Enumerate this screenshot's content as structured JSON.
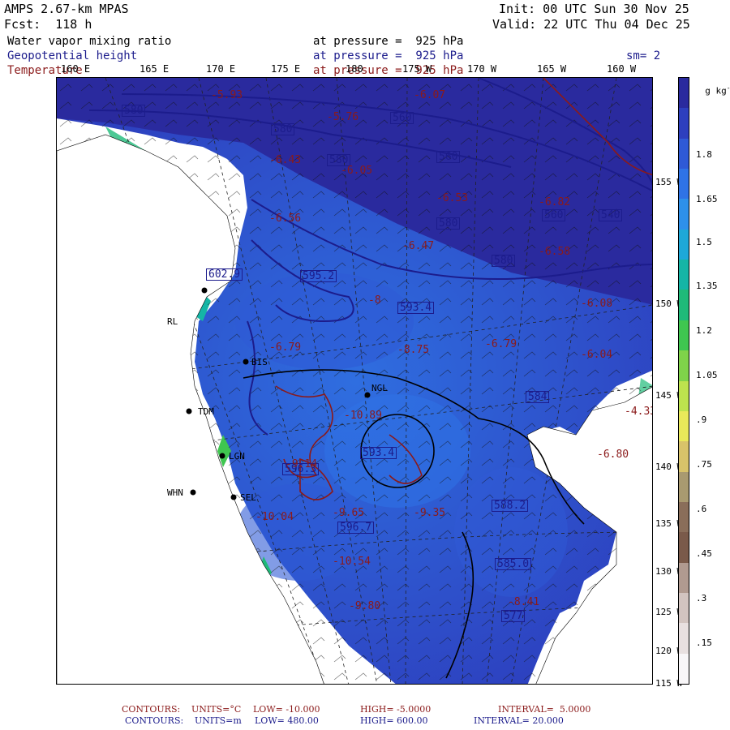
{
  "header": {
    "model": "AMPS 2.67-km MPAS",
    "forecast": "Fcst:  118 h",
    "init": "Init: 00 UTC Sun 30 Nov 25",
    "valid": "Valid: 22 UTC Thu 04 Dec 25",
    "smoothing": "sm= 2"
  },
  "fields": [
    {
      "name": "Water vapor mixing ratio",
      "level": "at pressure =  925 hPa",
      "color": "#000000"
    },
    {
      "name": "Geopotential height",
      "level": "at pressure =  925 hPa",
      "color": "#1c1c8c"
    },
    {
      "name": "Temperature",
      "level": "at pressure =  925 hPa",
      "color": "#8b1a1a"
    }
  ],
  "longitude_labels": [
    "160 E",
    "165 E",
    "170 E",
    "175 E",
    "180",
    "175 W",
    "170 W",
    "165 W",
    "160 W"
  ],
  "latitude_labels": [
    "155 W",
    "150 W",
    "145 W",
    "140 W",
    "135 W",
    "130 W",
    "125 W",
    "120 W",
    "115 W"
  ],
  "colorbar": {
    "unit": "g kg",
    "unit_exp": "-1",
    "labels": [
      "1.8",
      "1.65",
      "1.5",
      "1.35",
      "1.2",
      "1.05",
      ".9",
      ".75",
      ".6",
      ".45",
      ".3",
      ".15"
    ],
    "colors": [
      "#2a2a9e",
      "#2d3fbe",
      "#2f5ad6",
      "#2f73e6",
      "#2e90ea",
      "#1ea8d8",
      "#15b5a6",
      "#1fba79",
      "#3fc650",
      "#7fd34a",
      "#bde34e",
      "#e9e95a",
      "#d8c36a",
      "#a99a70",
      "#8a6e5a",
      "#7a5a4a",
      "#b09a90",
      "#d2c4c0",
      "#e8e0e0",
      "#f8f6f8"
    ]
  },
  "stations": [
    "BIS",
    "TDM",
    "NGL",
    "LGN",
    "SEL",
    "WHN",
    "RL"
  ],
  "height_contour_labels": [
    "580",
    "580",
    "580",
    "560",
    "560",
    "580",
    "560",
    "540",
    "580",
    "595.2",
    "593.4",
    "593.4",
    "596.3",
    "584",
    "588.2",
    "585.0",
    "577",
    "602.9",
    "596.7"
  ],
  "temperature_labels": [
    "-5.93",
    "-5.76",
    "-6.43",
    "-6.05",
    "-6.56",
    "-6.53",
    "-6.07",
    "-6.82",
    "-6.58",
    "-6.47",
    "-8",
    "-8.75",
    "-6.79",
    "-6.08",
    "-6.04",
    "-6.79",
    "-10.89",
    "-9.14",
    "-10.04",
    "-9.65",
    "-10.54",
    "-9.80",
    "-6.80",
    "-8.41",
    "-4.33",
    "-9.35"
  ],
  "footer": {
    "temp": {
      "label": "CONTOURS:",
      "units": "UNITS=°C",
      "low": "LOW= -10.000",
      "high": "HIGH= -5.0000",
      "interval": "INTERVAL=  5.0000"
    },
    "height": {
      "label": "CONTOURS:",
      "units": "UNITS=m",
      "low": "LOW= 480.00",
      "high": "HIGH= 600.00",
      "interval": "INTERVAL= 20.000"
    }
  }
}
